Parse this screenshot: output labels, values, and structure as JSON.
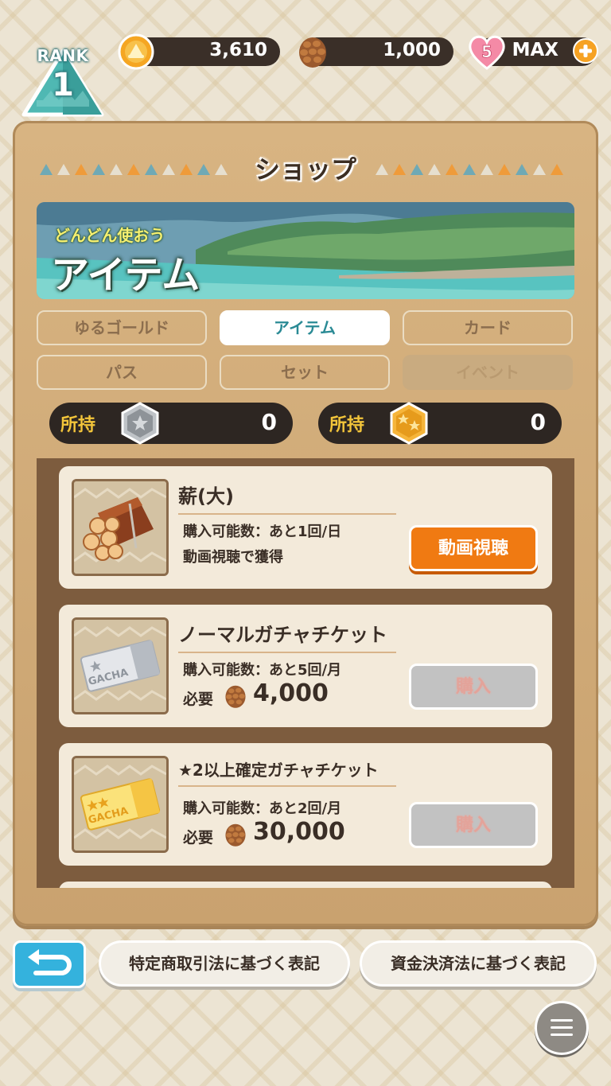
{
  "header": {
    "rank_label": "RANK",
    "rank_value": "1",
    "gold": "3,610",
    "pinecones": "1,000",
    "hearts": "5",
    "stamina": "MAX"
  },
  "shop": {
    "title": "ショップ",
    "banner": {
      "subtitle": "どんどん使おう",
      "title": "アイテム"
    },
    "tabs": [
      {
        "label": "ゆるゴールド",
        "state": "normal"
      },
      {
        "label": "アイテム",
        "state": "active"
      },
      {
        "label": "カード",
        "state": "normal"
      },
      {
        "label": "パス",
        "state": "normal"
      },
      {
        "label": "セット",
        "state": "normal"
      },
      {
        "label": "イベント",
        "state": "disabled"
      }
    ],
    "owned": [
      {
        "label": "所持",
        "icon": "silver-star-medal-icon",
        "value": "0"
      },
      {
        "label": "所持",
        "icon": "gold-star-medal-icon",
        "value": "0"
      }
    ],
    "items": [
      {
        "name": "薪(大)",
        "limit": "購入可能数：あと1回/日",
        "note": "動画視聴で獲得",
        "button": "動画視聴",
        "icon": "firewood-icon"
      },
      {
        "name": "ノーマルガチャチケット",
        "limit": "購入可能数：あと5回/月",
        "required_label": "必要",
        "price": "4,000",
        "button": "購入",
        "icon": "normal-gacha-ticket-icon",
        "ticket_text": "GACHA"
      },
      {
        "name": "★2以上確定ガチャチケット",
        "limit": "購入可能数：あと2回/月",
        "required_label": "必要",
        "price": "30,000",
        "button": "購入",
        "icon": "star2-gacha-ticket-icon",
        "ticket_text": "GACHA"
      }
    ]
  },
  "footer": {
    "legal_1": "特定商取引法に基づく表記",
    "legal_2": "資金決済法に基づく表記"
  },
  "colors": {
    "accent_teal": "#2a8a95",
    "video_orange": "#f07a12",
    "back_blue": "#34b2dd"
  }
}
